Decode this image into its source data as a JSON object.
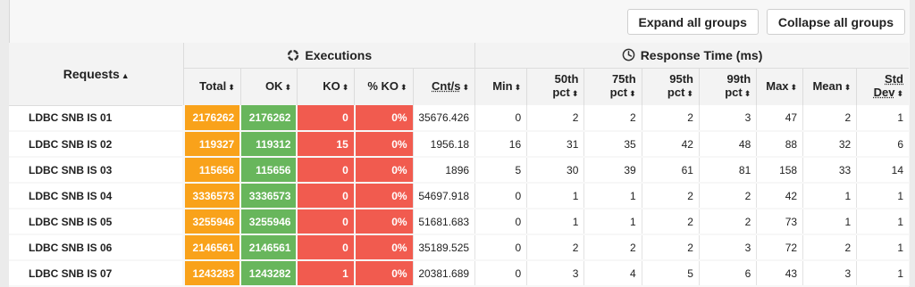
{
  "toolbar": {
    "expand_label": "Expand all groups",
    "collapse_label": "Collapse all groups"
  },
  "header": {
    "requests": "Requests",
    "executions": "Executions",
    "response_time": "Response Time (ms)",
    "columns": {
      "total": "Total",
      "ok": "OK",
      "ko": "KO",
      "pko": "% KO",
      "cnts": "Cnt/s",
      "min": "Min",
      "p50a": "50th",
      "p50b": "pct",
      "p75a": "75th",
      "p75b": "pct",
      "p95a": "95th",
      "p95b": "pct",
      "p99a": "99th",
      "p99b": "pct",
      "max": "Max",
      "mean": "Mean",
      "stda": "Std",
      "stdb": "Dev"
    }
  },
  "rows": [
    {
      "name": "LDBC SNB IS 01",
      "total": "2176262",
      "ok": "2176262",
      "ko": "0",
      "pko": "0%",
      "cnts": "35676.426",
      "min": "0",
      "p50": "2",
      "p75": "2",
      "p95": "2",
      "p99": "3",
      "max": "47",
      "mean": "2",
      "std": "1"
    },
    {
      "name": "LDBC SNB IS 02",
      "total": "119327",
      "ok": "119312",
      "ko": "15",
      "pko": "0%",
      "cnts": "1956.18",
      "min": "16",
      "p50": "31",
      "p75": "35",
      "p95": "42",
      "p99": "48",
      "max": "88",
      "mean": "32",
      "std": "6"
    },
    {
      "name": "LDBC SNB IS 03",
      "total": "115656",
      "ok": "115656",
      "ko": "0",
      "pko": "0%",
      "cnts": "1896",
      "min": "5",
      "p50": "30",
      "p75": "39",
      "p95": "61",
      "p99": "81",
      "max": "158",
      "mean": "33",
      "std": "14"
    },
    {
      "name": "LDBC SNB IS 04",
      "total": "3336573",
      "ok": "3336573",
      "ko": "0",
      "pko": "0%",
      "cnts": "54697.918",
      "min": "0",
      "p50": "1",
      "p75": "1",
      "p95": "2",
      "p99": "2",
      "max": "42",
      "mean": "1",
      "std": "1"
    },
    {
      "name": "LDBC SNB IS 05",
      "total": "3255946",
      "ok": "3255946",
      "ko": "0",
      "pko": "0%",
      "cnts": "51681.683",
      "min": "0",
      "p50": "1",
      "p75": "1",
      "p95": "2",
      "p99": "2",
      "max": "73",
      "mean": "1",
      "std": "1"
    },
    {
      "name": "LDBC SNB IS 06",
      "total": "2146561",
      "ok": "2146561",
      "ko": "0",
      "pko": "0%",
      "cnts": "35189.525",
      "min": "0",
      "p50": "2",
      "p75": "2",
      "p95": "2",
      "p99": "3",
      "max": "72",
      "mean": "2",
      "std": "1"
    },
    {
      "name": "LDBC SNB IS 07",
      "total": "1243283",
      "ok": "1243282",
      "ko": "1",
      "pko": "0%",
      "cnts": "20381.689",
      "min": "0",
      "p50": "3",
      "p75": "4",
      "p95": "5",
      "p99": "6",
      "max": "43",
      "mean": "3",
      "std": "1"
    }
  ],
  "colors": {
    "total": "#f9a21a",
    "ok": "#68b65c",
    "ko": "#f15b4f"
  },
  "icons": {
    "executions": "executions-ring-icon",
    "response_time": "clock-icon",
    "sort": "sort-arrows-icon"
  }
}
